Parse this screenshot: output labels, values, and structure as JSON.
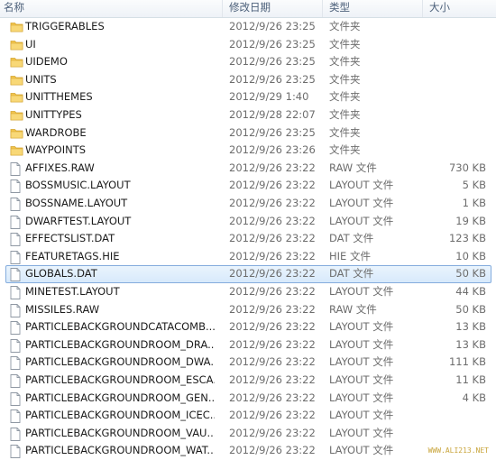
{
  "header": {
    "name": "名称",
    "date": "修改日期",
    "type": "类型",
    "size": "大小"
  },
  "files": [
    {
      "name": "TRIGGERABLES",
      "date": "2012/9/26 23:25",
      "type": "文件夹",
      "size": "",
      "icon": "folder-icon"
    },
    {
      "name": "UI",
      "date": "2012/9/26 23:25",
      "type": "文件夹",
      "size": "",
      "icon": "folder-icon"
    },
    {
      "name": "UIDEMO",
      "date": "2012/9/26 23:25",
      "type": "文件夹",
      "size": "",
      "icon": "folder-icon"
    },
    {
      "name": "UNITS",
      "date": "2012/9/26 23:25",
      "type": "文件夹",
      "size": "",
      "icon": "folder-icon"
    },
    {
      "name": "UNITTHEMES",
      "date": "2012/9/29 1:40",
      "type": "文件夹",
      "size": "",
      "icon": "folder-icon"
    },
    {
      "name": "UNITTYPES",
      "date": "2012/9/28 22:07",
      "type": "文件夹",
      "size": "",
      "icon": "folder-icon"
    },
    {
      "name": "WARDROBE",
      "date": "2012/9/26 23:25",
      "type": "文件夹",
      "size": "",
      "icon": "folder-icon"
    },
    {
      "name": "WAYPOINTS",
      "date": "2012/9/26 23:26",
      "type": "文件夹",
      "size": "",
      "icon": "folder-icon"
    },
    {
      "name": "AFFIXES.RAW",
      "date": "2012/9/26 23:22",
      "type": "RAW 文件",
      "size": "730 KB",
      "icon": "file-icon"
    },
    {
      "name": "BOSSMUSIC.LAYOUT",
      "date": "2012/9/26 23:22",
      "type": "LAYOUT 文件",
      "size": "5 KB",
      "icon": "file-icon"
    },
    {
      "name": "BOSSNAME.LAYOUT",
      "date": "2012/9/26 23:22",
      "type": "LAYOUT 文件",
      "size": "1 KB",
      "icon": "file-icon"
    },
    {
      "name": "DWARFTEST.LAYOUT",
      "date": "2012/9/26 23:22",
      "type": "LAYOUT 文件",
      "size": "19 KB",
      "icon": "file-icon"
    },
    {
      "name": "EFFECTSLIST.DAT",
      "date": "2012/9/26 23:22",
      "type": "DAT 文件",
      "size": "123 KB",
      "icon": "file-icon"
    },
    {
      "name": "FEATURETAGS.HIE",
      "date": "2012/9/26 23:22",
      "type": "HIE 文件",
      "size": "10 KB",
      "icon": "file-icon"
    },
    {
      "name": "GLOBALS.DAT",
      "date": "2012/9/26 23:22",
      "type": "DAT 文件",
      "size": "50 KB",
      "icon": "file-icon",
      "selected": true
    },
    {
      "name": "MINETEST.LAYOUT",
      "date": "2012/9/26 23:22",
      "type": "LAYOUT 文件",
      "size": "44 KB",
      "icon": "file-icon"
    },
    {
      "name": "MISSILES.RAW",
      "date": "2012/9/26 23:22",
      "type": "RAW 文件",
      "size": "50 KB",
      "icon": "file-icon"
    },
    {
      "name": "PARTICLEBACKGROUNDCATACOMB...",
      "date": "2012/9/26 23:22",
      "type": "LAYOUT 文件",
      "size": "13 KB",
      "icon": "file-icon"
    },
    {
      "name": "PARTICLEBACKGROUNDROOM_DRA...",
      "date": "2012/9/26 23:22",
      "type": "LAYOUT 文件",
      "size": "13 KB",
      "icon": "file-icon"
    },
    {
      "name": "PARTICLEBACKGROUNDROOM_DWA...",
      "date": "2012/9/26 23:22",
      "type": "LAYOUT 文件",
      "size": "111 KB",
      "icon": "file-icon"
    },
    {
      "name": "PARTICLEBACKGROUNDROOM_ESCA...",
      "date": "2012/9/26 23:22",
      "type": "LAYOUT 文件",
      "size": "11 KB",
      "icon": "file-icon"
    },
    {
      "name": "PARTICLEBACKGROUNDROOM_GEN...",
      "date": "2012/9/26 23:22",
      "type": "LAYOUT 文件",
      "size": "4 KB",
      "icon": "file-icon"
    },
    {
      "name": "PARTICLEBACKGROUNDROOM_ICEC...",
      "date": "2012/9/26 23:22",
      "type": "LAYOUT 文件",
      "size": "",
      "icon": "file-icon"
    },
    {
      "name": "PARTICLEBACKGROUNDROOM_VAU...",
      "date": "2012/9/26 23:22",
      "type": "LAYOUT 文件",
      "size": "",
      "icon": "file-icon"
    },
    {
      "name": "PARTICLEBACKGROUNDROOM_WAT...",
      "date": "2012/9/26 23:22",
      "type": "LAYOUT 文件",
      "size": "",
      "icon": "file-icon"
    }
  ],
  "watermark": {
    "url": "WWW.ALI213.NET"
  },
  "colors": {
    "folder": "#f2c54c",
    "selection_border": "#84acdd",
    "header_text": "#4c607a"
  }
}
